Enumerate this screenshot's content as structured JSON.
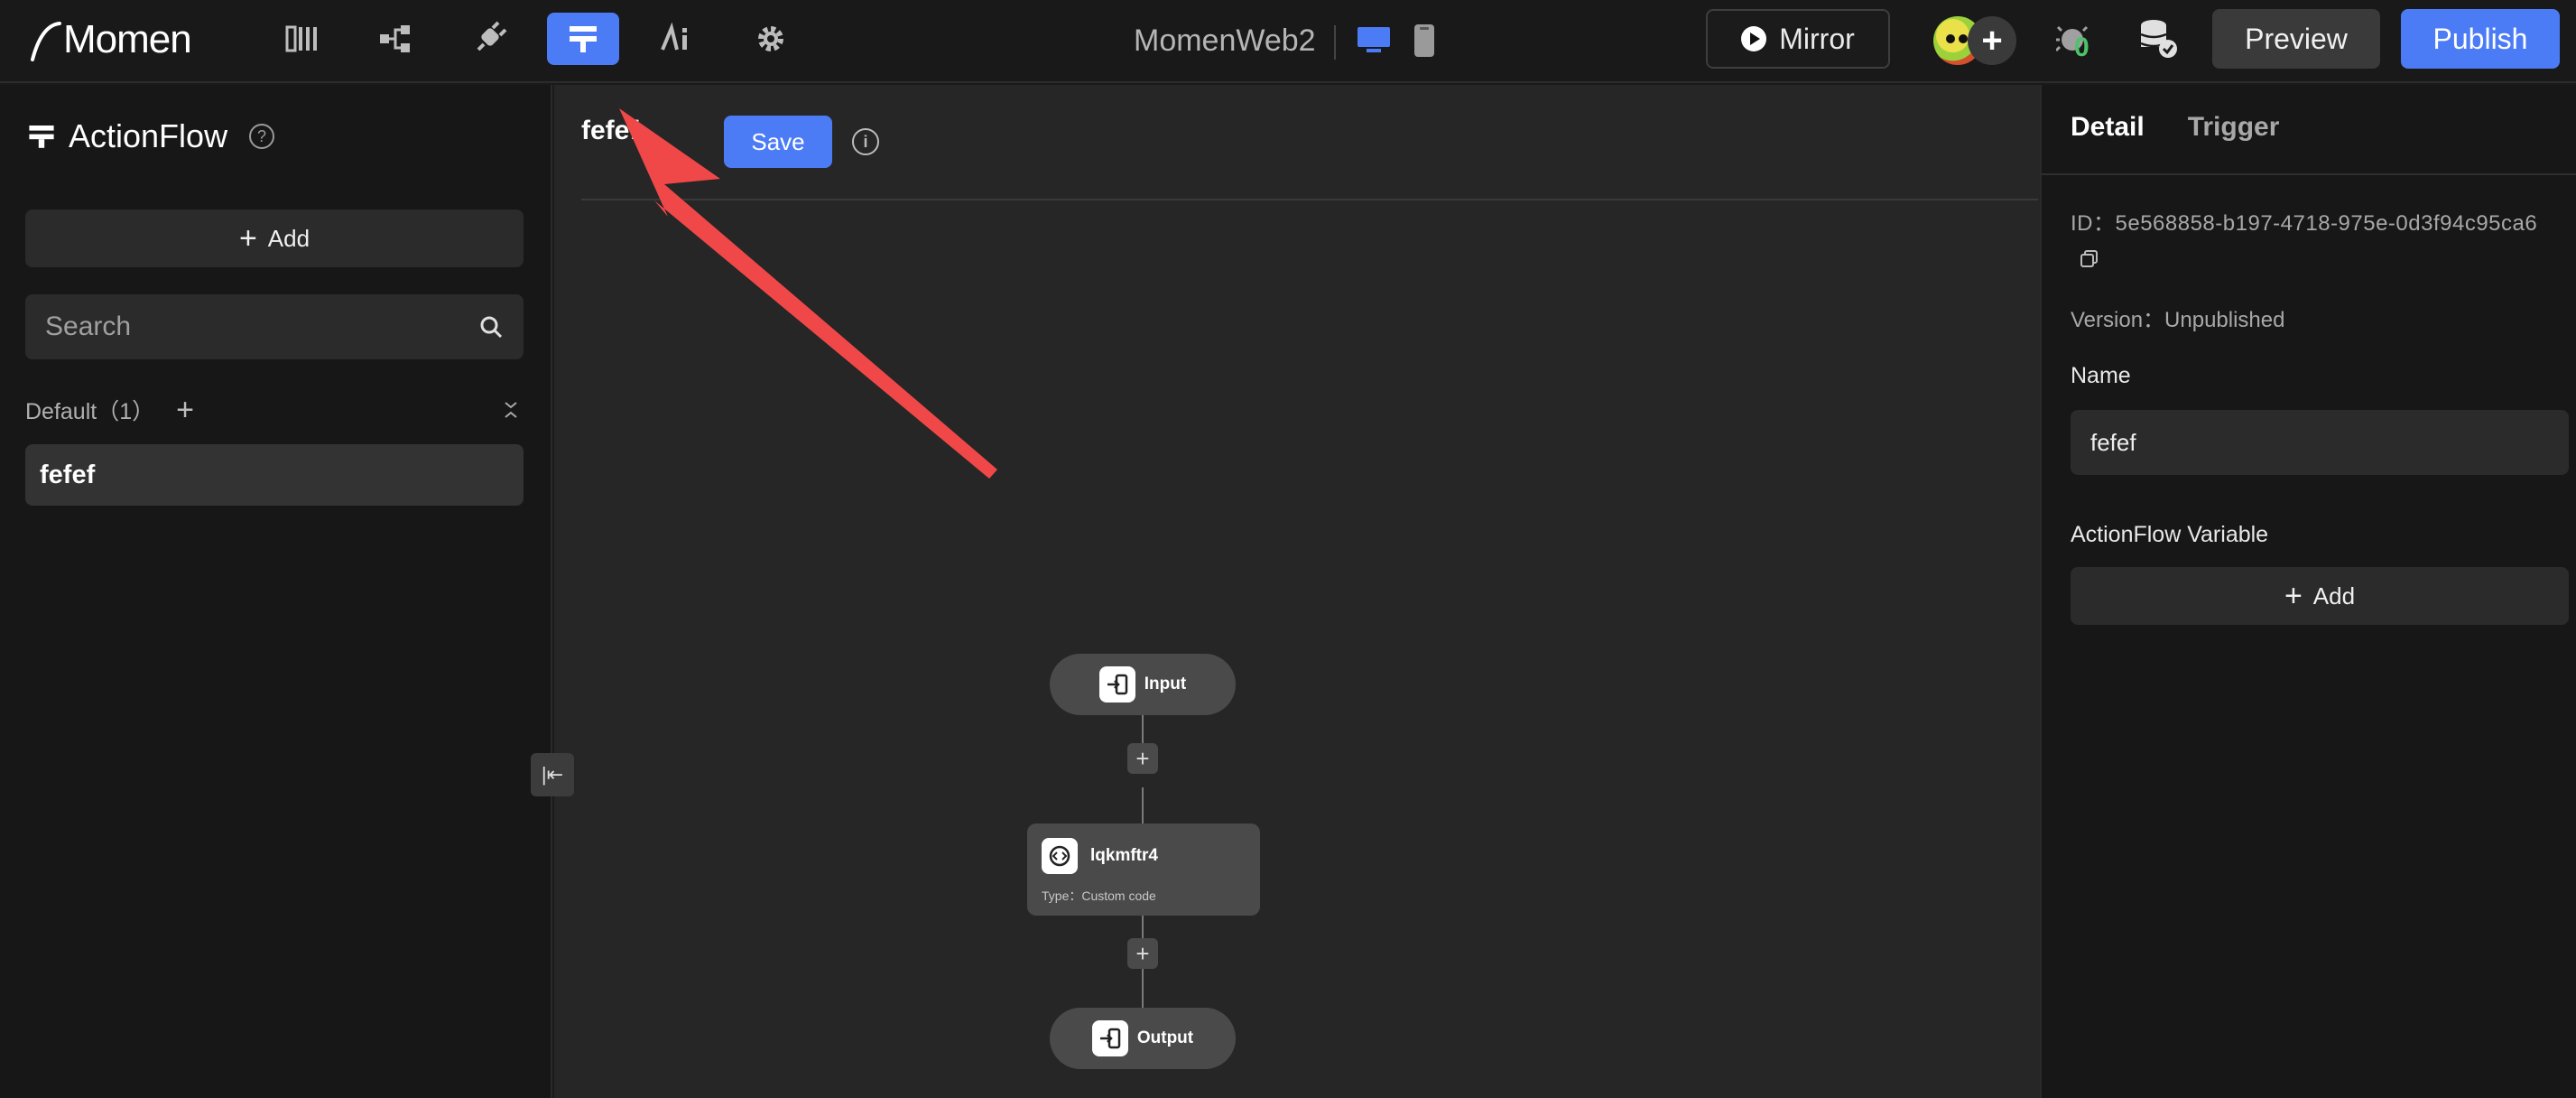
{
  "app": {
    "logo_text": "Momen",
    "project_name": "MomenWeb2"
  },
  "topbar": {
    "nav_icons": [
      "pages-icon",
      "data-model-icon",
      "plugin-icon",
      "actionflow-icon",
      "ai-icon",
      "settings-icon"
    ],
    "active_nav": "actionflow-icon",
    "mirror_label": "Mirror",
    "debug_count": "0",
    "preview_label": "Preview",
    "publish_label": "Publish",
    "accent_color": "#4c7cf5"
  },
  "sidebar": {
    "title": "ActionFlow",
    "add_label": "Add",
    "search_placeholder": "Search",
    "group_label": "Default（1）",
    "items": [
      {
        "label": "fefef"
      }
    ]
  },
  "canvas": {
    "flow_name": "fefef",
    "save_label": "Save",
    "nodes": {
      "input_label": "Input",
      "custom": {
        "name": "lqkmftr4",
        "type_text": "Type：Custom code"
      },
      "output_label": "Output"
    }
  },
  "detail_panel": {
    "tabs": [
      "Detail",
      "Trigger"
    ],
    "active_tab": "Detail",
    "id_text": "ID：5e568858-b197-4718-975e-0d3f94c95ca6",
    "version_text": "Version：Unpublished",
    "name_label": "Name",
    "name_value": "fefef",
    "variable_label": "ActionFlow Variable",
    "variable_add_label": "Add"
  }
}
